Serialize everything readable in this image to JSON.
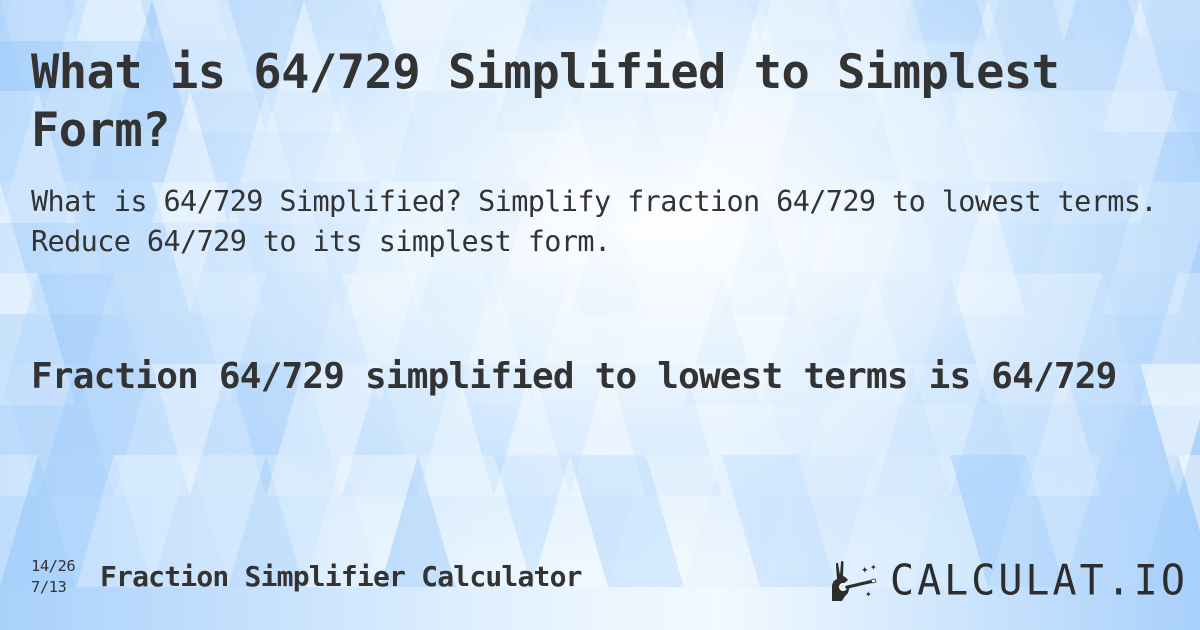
{
  "page": {
    "title": "What is 64/729 Simplified to Simplest Form?",
    "subtitle": "What is 64/729 Simplified? Simplify fraction 64/729 to lowest terms. Reduce 64/729 to its simplest form.",
    "answer": "Fraction 64/729 simplified to lowest terms is 64/729"
  },
  "footer": {
    "fraction_top": "14/26",
    "fraction_bottom": "7/13",
    "calculator_name": "Fraction Simplifier Calculator",
    "logo_text": "CALCULAT.IO",
    "logo_icon": "hand-magic-wand-icon"
  },
  "theme": {
    "text_color": "#333333",
    "bg_light": "#ffffff",
    "bg_mid": "#d6ebfd",
    "bg_dark": "#9fcbfb"
  }
}
